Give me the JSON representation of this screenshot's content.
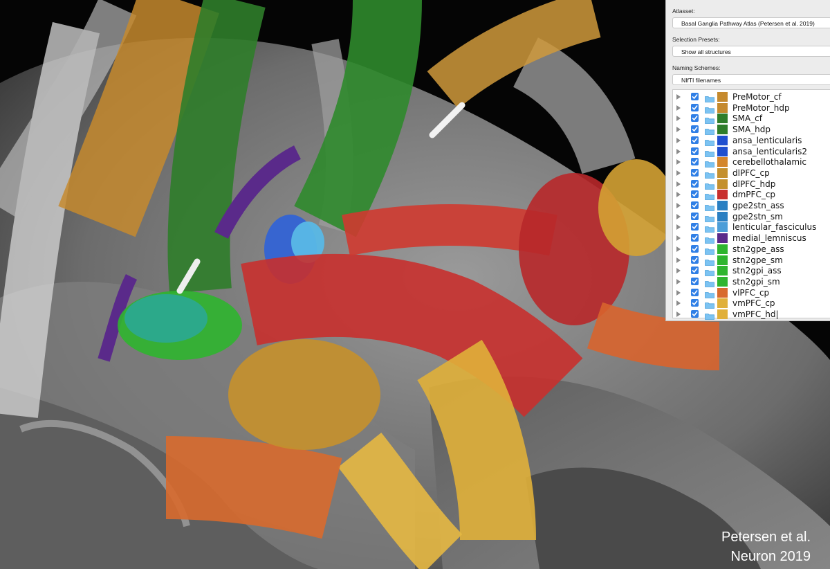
{
  "panel": {
    "atlasset_label": "Atlasset:",
    "atlasset_value": "Basal Ganglia Pathway Atlas (Petersen et al. 2019)",
    "presets_label": "Selection Presets:",
    "presets_value": "Show all structures",
    "naming_label": "Naming Schemes:",
    "naming_value": "NIfTI filenames",
    "structures": [
      {
        "label": "PreMotor_cf",
        "color": "#c58a2e",
        "checked": true
      },
      {
        "label": "PreMotor_hdp",
        "color": "#c58a2e",
        "checked": true
      },
      {
        "label": "SMA_cf",
        "color": "#2f7d2a",
        "checked": true
      },
      {
        "label": "SMA_hdp",
        "color": "#2f7d2a",
        "checked": true
      },
      {
        "label": "ansa_lenticularis",
        "color": "#1f4fcf",
        "checked": true
      },
      {
        "label": "ansa_lenticularis2",
        "color": "#1f4fcf",
        "checked": true
      },
      {
        "label": "cerebellothalamic",
        "color": "#d4862c",
        "checked": true
      },
      {
        "label": "dlPFC_cp",
        "color": "#c4902e",
        "checked": true
      },
      {
        "label": "dlPFC_hdp",
        "color": "#c4902e",
        "checked": true
      },
      {
        "label": "dmPFC_cp",
        "color": "#c8302e",
        "checked": true
      },
      {
        "label": "gpe2stn_ass",
        "color": "#2a7fc2",
        "checked": true
      },
      {
        "label": "gpe2stn_sm",
        "color": "#2a7fc2",
        "checked": true
      },
      {
        "label": "lenticular_fasciculus",
        "color": "#4d9ed8",
        "checked": true
      },
      {
        "label": "medial_lemniscus",
        "color": "#5a2a8a",
        "checked": true
      },
      {
        "label": "stn2gpe_ass",
        "color": "#2fb52f",
        "checked": true
      },
      {
        "label": "stn2gpe_sm",
        "color": "#2fb52f",
        "checked": true
      },
      {
        "label": "stn2gpi_ass",
        "color": "#2fb52f",
        "checked": true
      },
      {
        "label": "stn2gpi_sm",
        "color": "#2fb52f",
        "checked": true
      },
      {
        "label": "vlPFC_cp",
        "color": "#d86a2e",
        "checked": true
      },
      {
        "label": "vmPFC_cp",
        "color": "#e0b03a",
        "checked": true
      },
      {
        "label": "vmPFC_hd|",
        "color": "#e0b03a",
        "checked": true
      }
    ]
  },
  "caption": {
    "line1": "Petersen et al.",
    "line2": "Neuron 2019"
  }
}
